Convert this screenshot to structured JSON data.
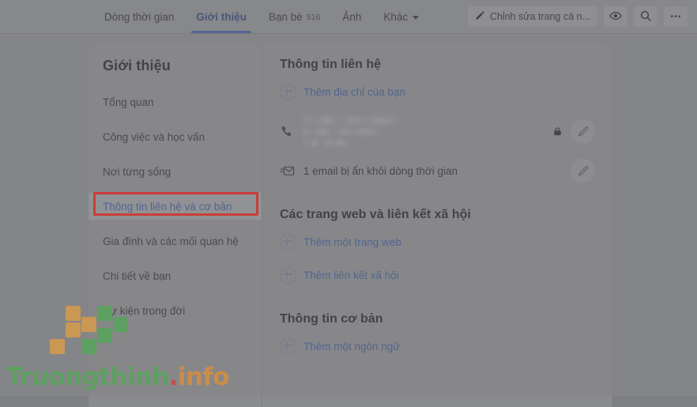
{
  "nav": {
    "tabs": [
      {
        "label": "Dòng thời gian",
        "count": "",
        "active": false
      },
      {
        "label": "Giới thiệu",
        "count": "",
        "active": true
      },
      {
        "label": "Bạn bè",
        "count": "516",
        "active": false
      },
      {
        "label": "Ảnh",
        "count": "",
        "active": false
      },
      {
        "label": "Khác",
        "count": "",
        "active": false,
        "caret": true
      }
    ],
    "actions": {
      "edit_profile_label": "Chỉnh sửa trang cá n...",
      "edit_profile_icon": "pencil-icon",
      "view_as_icon": "eye-icon",
      "search_icon": "search-icon",
      "more_icon": "ellipsis-icon"
    }
  },
  "sidebar": {
    "title": "Giới thiệu",
    "items": [
      {
        "label": "Tổng quan",
        "selected": false
      },
      {
        "label": "Công việc và học vấn",
        "selected": false
      },
      {
        "label": "Nơi từng sống",
        "selected": false
      },
      {
        "label": "Thông tin liên hệ và cơ bản",
        "selected": true
      },
      {
        "label": "Gia đình và các mối quan hệ",
        "selected": false
      },
      {
        "label": "Chi tiết về bạn",
        "selected": false
      },
      {
        "label": "Sự kiện trong đời",
        "selected": false
      }
    ]
  },
  "main": {
    "contact": {
      "heading": "Thông tin liên hệ",
      "add_address_label": "Thêm địa chỉ của bạn",
      "add_address_icon": "plus-circle-icon",
      "phone": {
        "icon": "phone-icon",
        "value": "",
        "privacy_icon": "lock-icon",
        "edit_icon": "pencil-edit-icon"
      },
      "email": {
        "icon": "hidden-email-icon",
        "label": "1 email bị ẩn khỏi dòng thời gian",
        "edit_icon": "pencil-edit-icon"
      }
    },
    "websites": {
      "heading": "Các trang web và liên kết xã hội",
      "add_website_label": "Thêm một trang web",
      "add_website_icon": "plus-circle-icon",
      "add_social_label": "Thêm liên kết xã hội",
      "add_social_icon": "plus-circle-icon"
    },
    "basic": {
      "heading": "Thông tin cơ bản",
      "add_language_label": "Thêm một ngôn ngữ",
      "add_language_icon": "plus-circle-icon"
    }
  },
  "annotation": {
    "highlight_color": "#ee1b11",
    "target_label": "Thông tin liên hệ và cơ bản"
  },
  "watermark": {
    "text_primary": "Truongthinh",
    "text_dot": ".",
    "text_suffix": "info",
    "color_primary": "#4cb050",
    "color_dot": "#e8332a",
    "color_suffix": "#f0932a"
  }
}
